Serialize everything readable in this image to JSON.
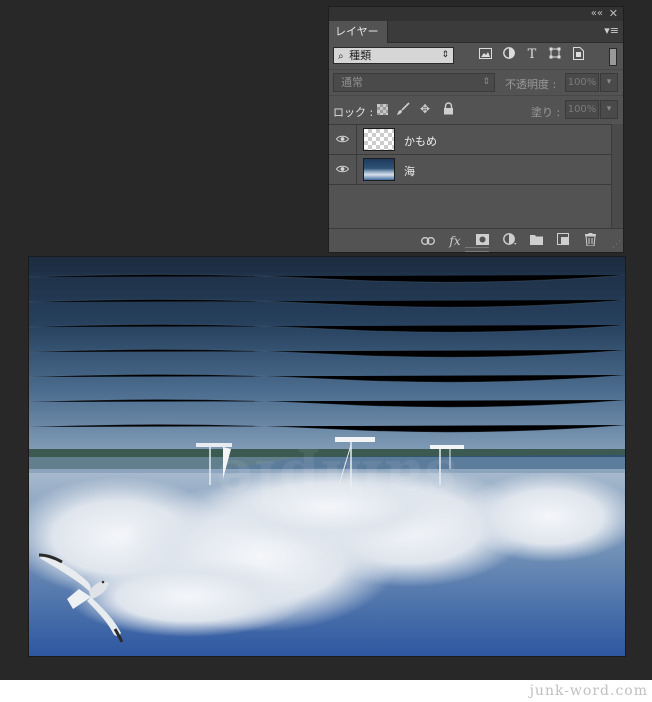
{
  "panel": {
    "tab_label": "レイヤー",
    "collapse_glyph": "««",
    "close_glyph": "✕",
    "menu_glyph": "▾≡",
    "filter": {
      "search_glyph": "⌕",
      "value": "種類"
    },
    "filter_icons": [
      "image-filter-icon",
      "adjustment-filter-icon",
      "type-filter-icon",
      "shape-filter-icon",
      "smart-object-filter-icon"
    ],
    "blend_mode": "通常",
    "opacity_label": "不透明度 :",
    "opacity_value": "100%",
    "lock_label": "ロック :",
    "fill_label": "塗り :",
    "fill_value": "100%",
    "layers": [
      {
        "name": "かもめ",
        "visible": true,
        "thumbnail": "transparent"
      },
      {
        "name": "海",
        "visible": true,
        "thumbnail": "sea"
      }
    ],
    "bottom_icons": [
      "link-layers-icon",
      "fx-icon",
      "add-mask-icon",
      "adjustment-layer-icon",
      "new-group-icon",
      "new-layer-icon",
      "delete-layer-icon"
    ]
  },
  "canvas": {
    "watermark_text": "sample"
  },
  "footer": {
    "watermark": "junk-word.com"
  },
  "colors": {
    "workspace": "#282828",
    "panel": "#535353",
    "panel_dark": "#323232"
  }
}
